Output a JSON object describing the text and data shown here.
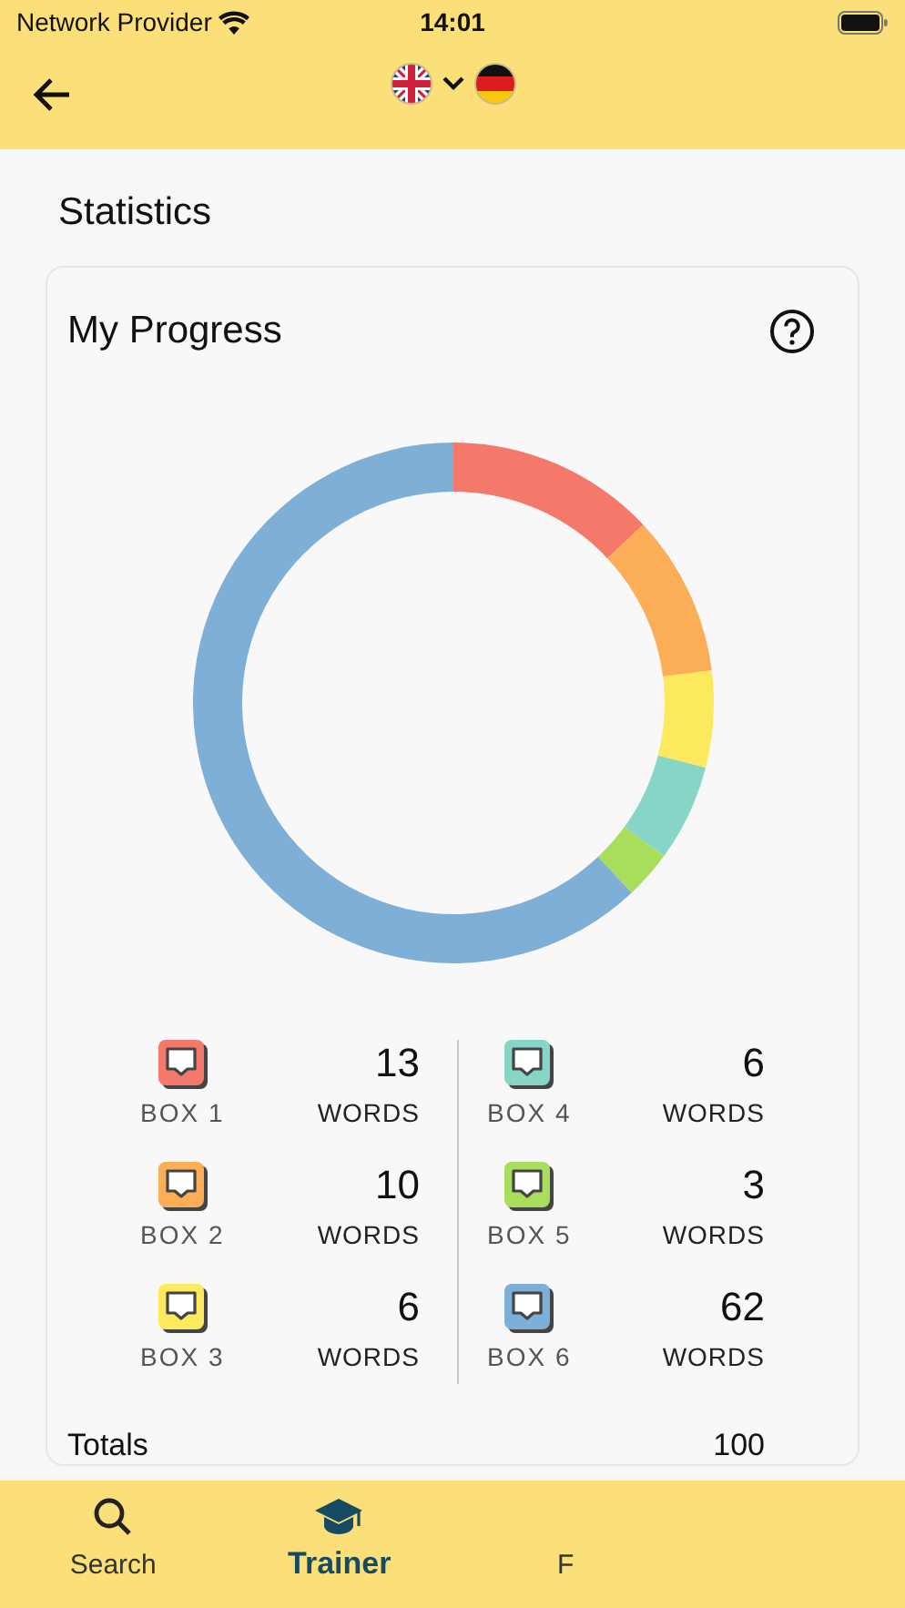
{
  "status_bar": {
    "carrier": "Network Provider",
    "time": "14:01"
  },
  "title": "Statistics",
  "progress": {
    "title": "My Progress",
    "chart_data": {
      "type": "donut",
      "values": [
        13,
        10,
        6,
        6,
        3,
        62
      ],
      "colors": [
        "#f5796a",
        "#fbae55",
        "#fde95e",
        "#86d5c6",
        "#a9dd5c",
        "#7eafd6"
      ]
    },
    "boxes": [
      {
        "label": "BOX 1",
        "count": "13",
        "unit": "WORDS",
        "color": "#f5796a"
      },
      {
        "label": "BOX 2",
        "count": "10",
        "unit": "WORDS",
        "color": "#fbae55"
      },
      {
        "label": "BOX 3",
        "count": "6",
        "unit": "WORDS",
        "color": "#fde95e"
      },
      {
        "label": "BOX 4",
        "count": "6",
        "unit": "WORDS",
        "color": "#86d5c6"
      },
      {
        "label": "BOX 5",
        "count": "3",
        "unit": "WORDS",
        "color": "#a9dd5c"
      },
      {
        "label": "BOX 6",
        "count": "62",
        "unit": "WORDS",
        "color": "#7eafd6"
      }
    ],
    "totals": {
      "label": "Totals",
      "value": "100"
    }
  },
  "tabs": [
    {
      "label": "Search",
      "kind": "search",
      "selected": false
    },
    {
      "label": "Trainer",
      "kind": "trainer",
      "selected": true
    },
    {
      "label": "F",
      "kind": "blank",
      "selected": false
    }
  ]
}
